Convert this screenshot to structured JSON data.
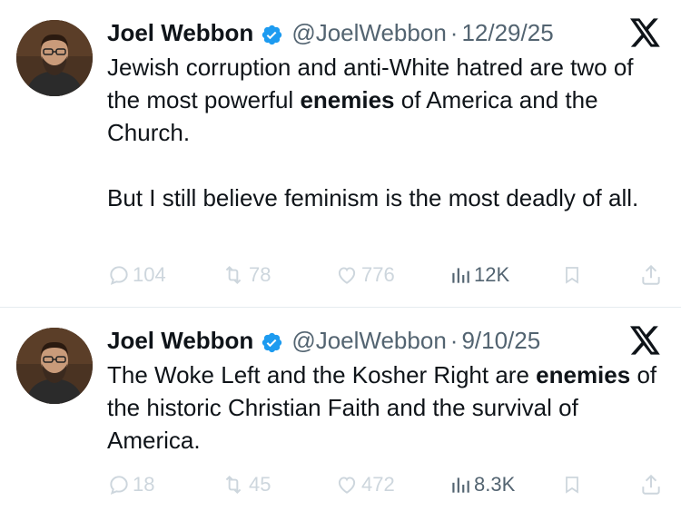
{
  "tweets": [
    {
      "author": {
        "name": "Joel Webbon",
        "handle": "@JoelWebbon",
        "verified": true
      },
      "separator": "·",
      "date": "12/29/25",
      "paragraphs": [
        {
          "before": "Jewish corruption and anti-White hatred are two of the most powerful ",
          "bold": "enemies",
          "after": " of America and the Church."
        },
        {
          "text": "But I still believe feminism is the most deadly of all."
        }
      ],
      "stats": {
        "replies": "104",
        "retweets": "78",
        "likes": "776",
        "views": "12K"
      }
    },
    {
      "author": {
        "name": "Joel Webbon",
        "handle": "@JoelWebbon",
        "verified": true
      },
      "separator": "·",
      "date": "9/10/25",
      "paragraphs": [
        {
          "before": "The Woke Left and the Kosher Right are ",
          "bold": "enemies",
          "after": " of the historic Christian Faith and the survival of America."
        }
      ],
      "stats": {
        "replies": "18",
        "retweets": "45",
        "likes": "472",
        "views": "8.3K"
      }
    }
  ],
  "icons": {
    "verified": "verified-badge-icon",
    "platform": "x-logo-icon",
    "reply": "reply-icon",
    "retweet": "retweet-icon",
    "like": "heart-icon",
    "views": "views-chart-icon",
    "bookmark": "bookmark-icon",
    "share": "share-icon"
  },
  "colors": {
    "verified": "#1d9bf0",
    "text": "#0f1419",
    "secondary": "#536471",
    "faded_action": "#cdd6dd"
  }
}
